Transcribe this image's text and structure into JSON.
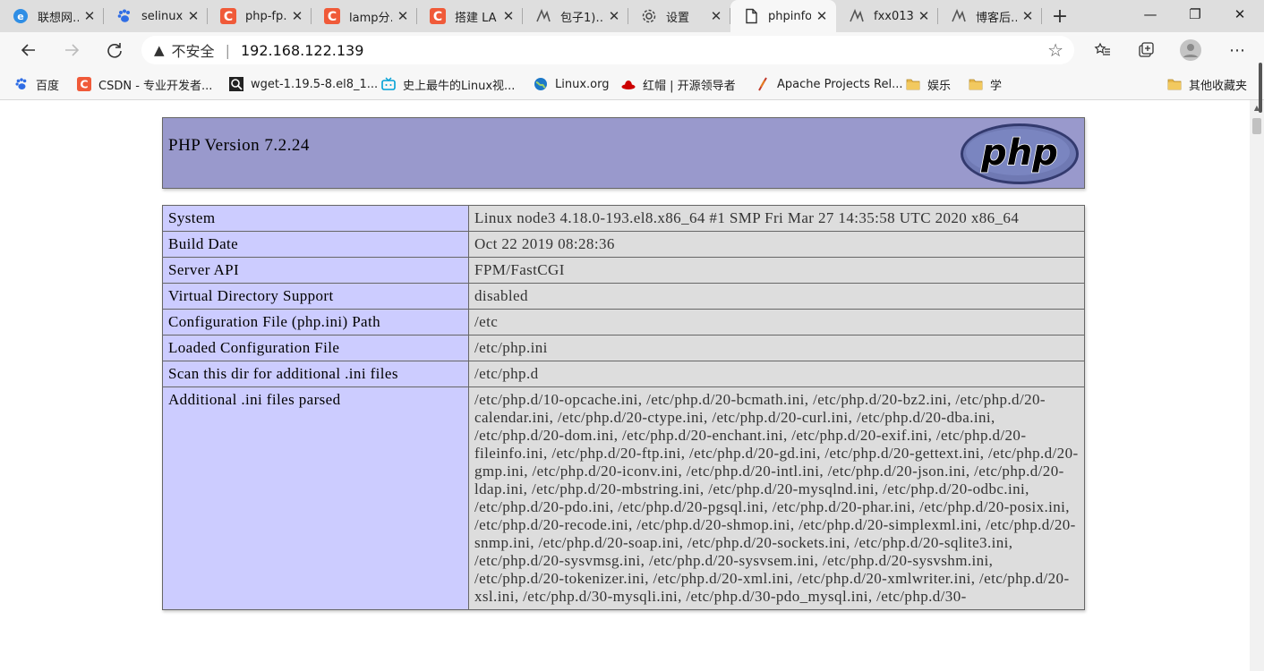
{
  "tabs": [
    {
      "label": "联想网…",
      "icon": "e",
      "color": "#2f8ee5"
    },
    {
      "label": "selinux…",
      "icon": "paw",
      "color": "#2f6de5"
    },
    {
      "label": "php-fp…",
      "icon": "C",
      "color": "#f05a39"
    },
    {
      "label": "lamp分…",
      "icon": "C",
      "color": "#f05a39"
    },
    {
      "label": "搭建 LA…",
      "icon": "C",
      "color": "#f05a39"
    },
    {
      "label": "包子1)…",
      "icon": "cnblogs",
      "color": "#555555"
    },
    {
      "label": "设置",
      "icon": "gear",
      "color": "#555555"
    },
    {
      "label": "phpinfo",
      "icon": "page",
      "color": "#555555"
    },
    {
      "label": "fxx013…",
      "icon": "cnblogs",
      "color": "#555555"
    },
    {
      "label": "博客后…",
      "icon": "cnblogs",
      "color": "#555555"
    }
  ],
  "address": {
    "warning": "不安全",
    "url": "192.168.122.139"
  },
  "bookmarks": [
    {
      "label": "百度",
      "color": "#2f6de5"
    },
    {
      "label": "CSDN - 专业开发者...",
      "color": "#f05a39"
    },
    {
      "label": "wget-1.19.5-8.el8_1...",
      "color": "#222222"
    },
    {
      "label": "史上最牛的Linux视...",
      "color": "#00a1d6"
    },
    {
      "label": "Linux.org",
      "color": "#1c78c8"
    },
    {
      "label": "红帽 | 开源领导者",
      "color": "#cc0000"
    },
    {
      "label": "Apache Projects Rel...",
      "color": "#c0392b"
    },
    {
      "label": "娱乐",
      "color": "#e8b84a"
    },
    {
      "label": "学",
      "color": "#e8b84a"
    },
    {
      "label": "其他收藏夹",
      "color": "#e8b84a"
    }
  ],
  "php": {
    "version_title": "PHP Version 7.2.24",
    "logo_text": "php",
    "rows": [
      {
        "key": "System",
        "value": "Linux node3 4.18.0-193.el8.x86_64 #1 SMP Fri Mar 27 14:35:58 UTC 2020 x86_64"
      },
      {
        "key": "Build Date",
        "value": "Oct 22 2019 08:28:36"
      },
      {
        "key": "Server API",
        "value": "FPM/FastCGI"
      },
      {
        "key": "Virtual Directory Support",
        "value": "disabled"
      },
      {
        "key": "Configuration File (php.ini) Path",
        "value": "/etc"
      },
      {
        "key": "Loaded Configuration File",
        "value": "/etc/php.ini"
      },
      {
        "key": "Scan this dir for additional .ini files",
        "value": "/etc/php.d"
      },
      {
        "key": "Additional .ini files parsed",
        "value": "/etc/php.d/10-opcache.ini, /etc/php.d/20-bcmath.ini, /etc/php.d/20-bz2.ini, /etc/php.d/20-calendar.ini, /etc/php.d/20-ctype.ini, /etc/php.d/20-curl.ini, /etc/php.d/20-dba.ini, /etc/php.d/20-dom.ini, /etc/php.d/20-enchant.ini, /etc/php.d/20-exif.ini, /etc/php.d/20-fileinfo.ini, /etc/php.d/20-ftp.ini, /etc/php.d/20-gd.ini, /etc/php.d/20-gettext.ini, /etc/php.d/20-gmp.ini, /etc/php.d/20-iconv.ini, /etc/php.d/20-intl.ini, /etc/php.d/20-json.ini, /etc/php.d/20-ldap.ini, /etc/php.d/20-mbstring.ini, /etc/php.d/20-mysqlnd.ini, /etc/php.d/20-odbc.ini, /etc/php.d/20-pdo.ini, /etc/php.d/20-pgsql.ini, /etc/php.d/20-phar.ini, /etc/php.d/20-posix.ini, /etc/php.d/20-recode.ini, /etc/php.d/20-shmop.ini, /etc/php.d/20-simplexml.ini, /etc/php.d/20-snmp.ini, /etc/php.d/20-soap.ini, /etc/php.d/20-sockets.ini, /etc/php.d/20-sqlite3.ini, /etc/php.d/20-sysvmsg.ini, /etc/php.d/20-sysvsem.ini, /etc/php.d/20-sysvshm.ini, /etc/php.d/20-tokenizer.ini, /etc/php.d/20-xml.ini, /etc/php.d/20-xmlwriter.ini, /etc/php.d/20-xsl.ini, /etc/php.d/30-mysqli.ini, /etc/php.d/30-pdo_mysql.ini, /etc/php.d/30-"
      }
    ]
  }
}
